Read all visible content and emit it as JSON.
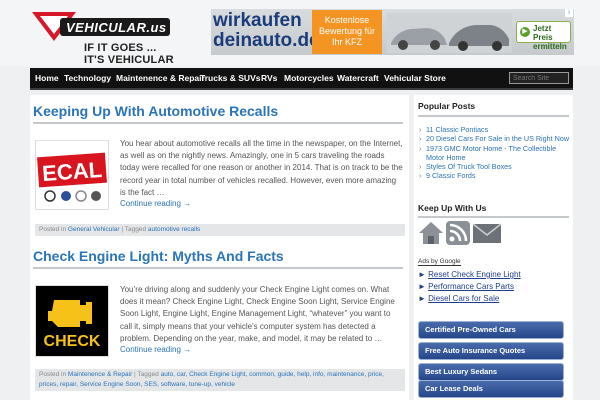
{
  "site": {
    "logo_text": "VEHICULAR.us",
    "tagline_1": "IF IT GOES ...",
    "tagline_2": "IT'S VEHICULAR"
  },
  "ad_banner": {
    "brand_part1": "wirkaufen",
    "brand_part2": "deinauto.de",
    "offer_line1": "Kostenlose",
    "offer_line2": "Bewertung für",
    "offer_line3": "Ihr KFZ",
    "cta_line1": "Jetzt Preis",
    "cta_line2": "ermitteln",
    "cta_arrow": "▶"
  },
  "nav": {
    "items": [
      "Home",
      "Technology",
      "Maintenence & Repair",
      "Trucks & SUVs",
      "RVs",
      "Motorcycles",
      "Watercraft",
      "Vehicular Store"
    ],
    "search_placeholder": "Search Site"
  },
  "posts": [
    {
      "title": "Keeping Up With Automotive Recalls",
      "excerpt": "You hear about automotive recalls all the time in the newspaper, on the Internet, as well as on the nightly news. Amazingly, one in 5 cars traveling the roads today were recalled for one reason or another in 2014. That is on track to be the record year in total number of vehicles recalled. However, even more amazing is the fact …",
      "more": "Continue reading →",
      "thumb_text": "ECAL",
      "meta_posted": "Posted in ",
      "meta_category": "General Vehicular",
      "meta_sep": " | Tagged ",
      "meta_tags": "automotive recalls"
    },
    {
      "title": "Check Engine Light: Myths And Facts",
      "excerpt": "You’re driving along and suddenly your Check Engine Light comes on. What does it mean? Check Engine Light, Check Engine Soon Light, Service Engine Soon Light, Engine Light, Engine Management Light, “whatever” you want to call it, simply means that your vehicle’s computer system has detected a problem. Depending on the year, make, and model, it may be related to …",
      "more": "Continue reading →",
      "thumb_text": "CHECK",
      "meta_posted": "Posted in ",
      "meta_category": "Maintenence & Repair",
      "meta_sep": " | Tagged ",
      "meta_tags": "auto, car, Check Engine Light, common, guide, help, info, maintenance, price, prices, repair, Service Engine Soon, SES, software, tune-up, vehicle"
    }
  ],
  "sidebar": {
    "popular_title": "Popular Posts",
    "popular": [
      "11 Classic Pontiacs",
      "20 Diesel Cars For Sale in the US Right Now",
      "1973 GMC Motor Home - The Collectible Motor Home",
      "Styles Of Truck Tool Boxes",
      "9 Classic Fords"
    ],
    "keep_title": "Keep Up With Us",
    "ads_by": "Ads by Google",
    "ad_links": [
      "Reset Check Engine Light",
      "Performance Cars Parts",
      "Diesel Cars for Sale"
    ],
    "ad_link_marker": "►",
    "buttons": [
      "Certified Pre-Owned Cars",
      "Free Auto Insurance Quotes",
      "Best Luxury Sedans",
      "Car Lease Deals"
    ]
  },
  "colors": {
    "link_blue": "#2a74b8",
    "nav_bg": "#111111",
    "ad_orange": "#f39423",
    "button_blue": "#25468a"
  }
}
